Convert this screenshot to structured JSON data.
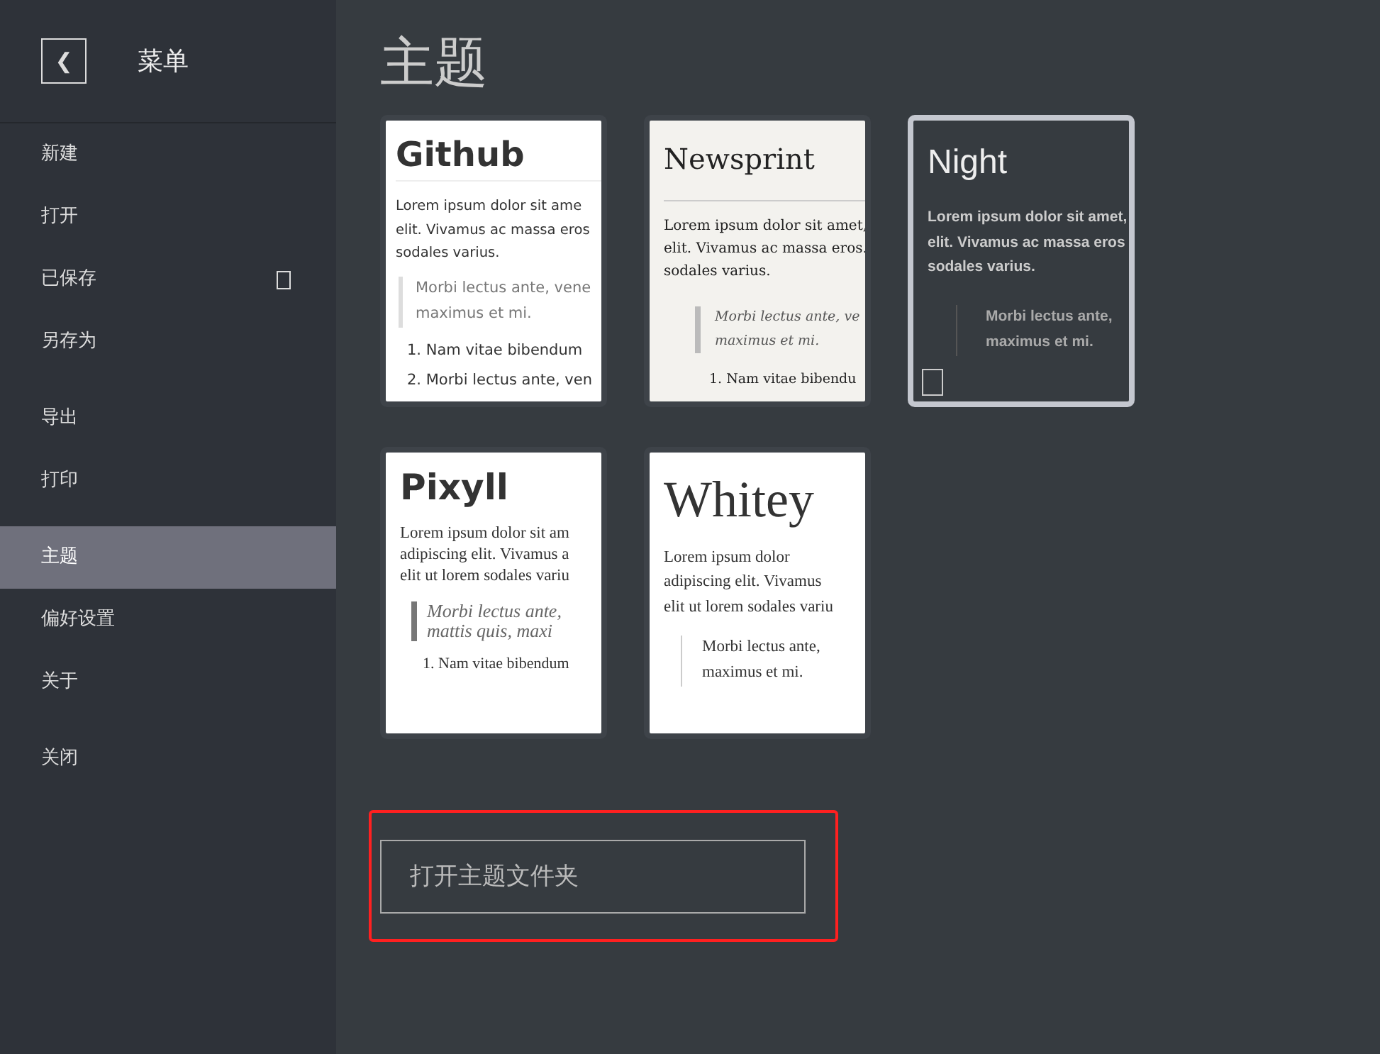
{
  "sidebar": {
    "back_label": "❮",
    "title": "菜单",
    "groups": [
      [
        {
          "kind": "plain",
          "label": "新建",
          "selected": false
        },
        {
          "kind": "plain",
          "label": "打开",
          "selected": false
        },
        {
          "kind": "with_square",
          "label": "已保存",
          "selected": false
        },
        {
          "kind": "plain",
          "label": "另存为",
          "selected": false
        }
      ],
      [
        {
          "kind": "plain",
          "label": "导出",
          "selected": false
        },
        {
          "kind": "plain",
          "label": "打印",
          "selected": false
        }
      ],
      [
        {
          "kind": "plain",
          "label": "主题",
          "selected": true
        },
        {
          "kind": "plain",
          "label": "偏好设置",
          "selected": false
        },
        {
          "kind": "plain",
          "label": "关于",
          "selected": false
        }
      ],
      [
        {
          "kind": "plain",
          "label": "关闭",
          "selected": false
        }
      ]
    ]
  },
  "main": {
    "title": "主题",
    "themes": [
      {
        "kind": "github",
        "title": "Github",
        "selected": false,
        "paragraph": [
          "Lorem ipsum dolor sit ame",
          "elit. Vivamus ac massa eros",
          "sodales varius."
        ],
        "quote": [
          "Morbi lectus ante, vene",
          "maximus et mi."
        ],
        "list": [
          "1. Nam vitae bibendum",
          "2. Morbi lectus ante, ven"
        ]
      },
      {
        "kind": "newsprint",
        "title": "Newsprint",
        "selected": false,
        "paragraph": [
          "Lorem ipsum dolor sit amet,",
          "elit. Vivamus ac massa eros.",
          "sodales varius."
        ],
        "quote": [
          "Morbi lectus ante, ve",
          "maximus et mi."
        ],
        "list": [
          "1. Nam vitae bibendu"
        ]
      },
      {
        "kind": "night",
        "title": "Night",
        "selected": true,
        "paragraph": [
          "Lorem ipsum dolor sit amet,",
          "elit. Vivamus ac massa eros",
          "sodales varius."
        ],
        "quote": [
          "Morbi lectus ante,",
          "maximus et mi."
        ]
      },
      {
        "kind": "pixyll",
        "title": "Pixyll",
        "selected": false,
        "paragraph": [
          "Lorem ipsum dolor sit am",
          "adipiscing elit. Vivamus a",
          "elit ut lorem sodales variu"
        ],
        "quote": [
          "Morbi lectus ante,",
          "mattis quis, maxi"
        ],
        "list": [
          "1. Nam vitae bibendum"
        ]
      },
      {
        "kind": "whitey",
        "title": "Whitey",
        "selected": false,
        "paragraph": [
          "Lorem ipsum dolor",
          "adipiscing elit. Vivamus",
          "elit ut lorem sodales variu"
        ],
        "quote": [
          "Morbi lectus ante,",
          "maximus et mi."
        ]
      }
    ],
    "open_folder_button": {
      "label": "打开主题文件夹",
      "highlighted": true
    }
  }
}
